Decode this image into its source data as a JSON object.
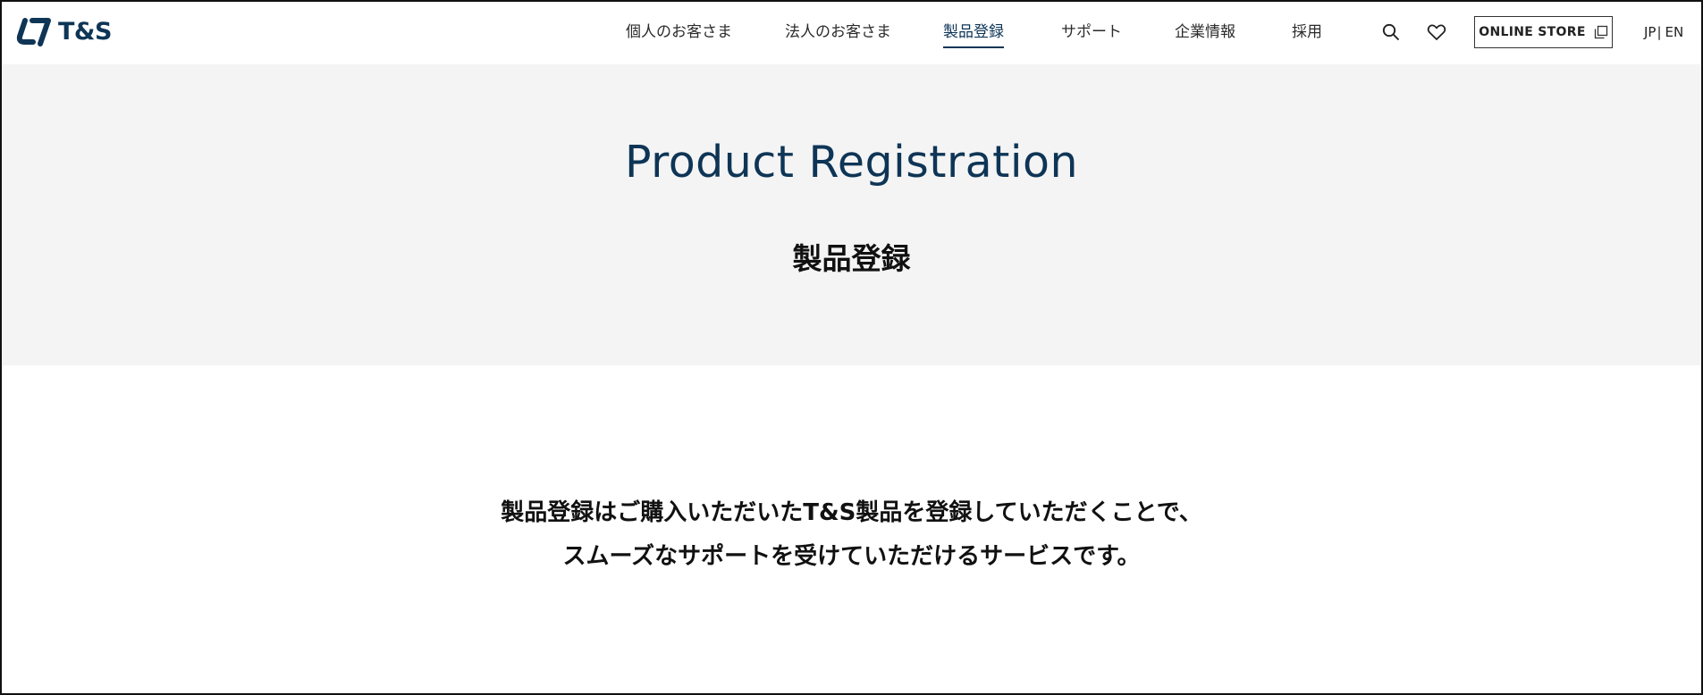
{
  "header": {
    "logo_text": "T&S",
    "nav": [
      {
        "label": "個人のお客さま",
        "active": false
      },
      {
        "label": "法人のお客さま",
        "active": false
      },
      {
        "label": "製品登録",
        "active": true
      },
      {
        "label": "サポート",
        "active": false
      },
      {
        "label": "企業情報",
        "active": false
      },
      {
        "label": "採用",
        "active": false
      }
    ],
    "icons": {
      "search": "search-icon",
      "favorite": "heart-icon",
      "external": "external-window-icon"
    },
    "online_store_label": "ONLINE STORE",
    "language": {
      "jp": "JP",
      "separator": "|",
      "en": "EN"
    }
  },
  "hero": {
    "title": "Product Registration",
    "subtitle": "製品登録"
  },
  "intro": {
    "line1": "製品登録はご購入いただいたT&S製品を登録していただくことで、",
    "line2": "スムーズなサポートを受けていただけるサービスです。"
  },
  "colors": {
    "brand_navy": "#0e3556",
    "hero_background": "#f4f4f4",
    "text": "#111111"
  }
}
